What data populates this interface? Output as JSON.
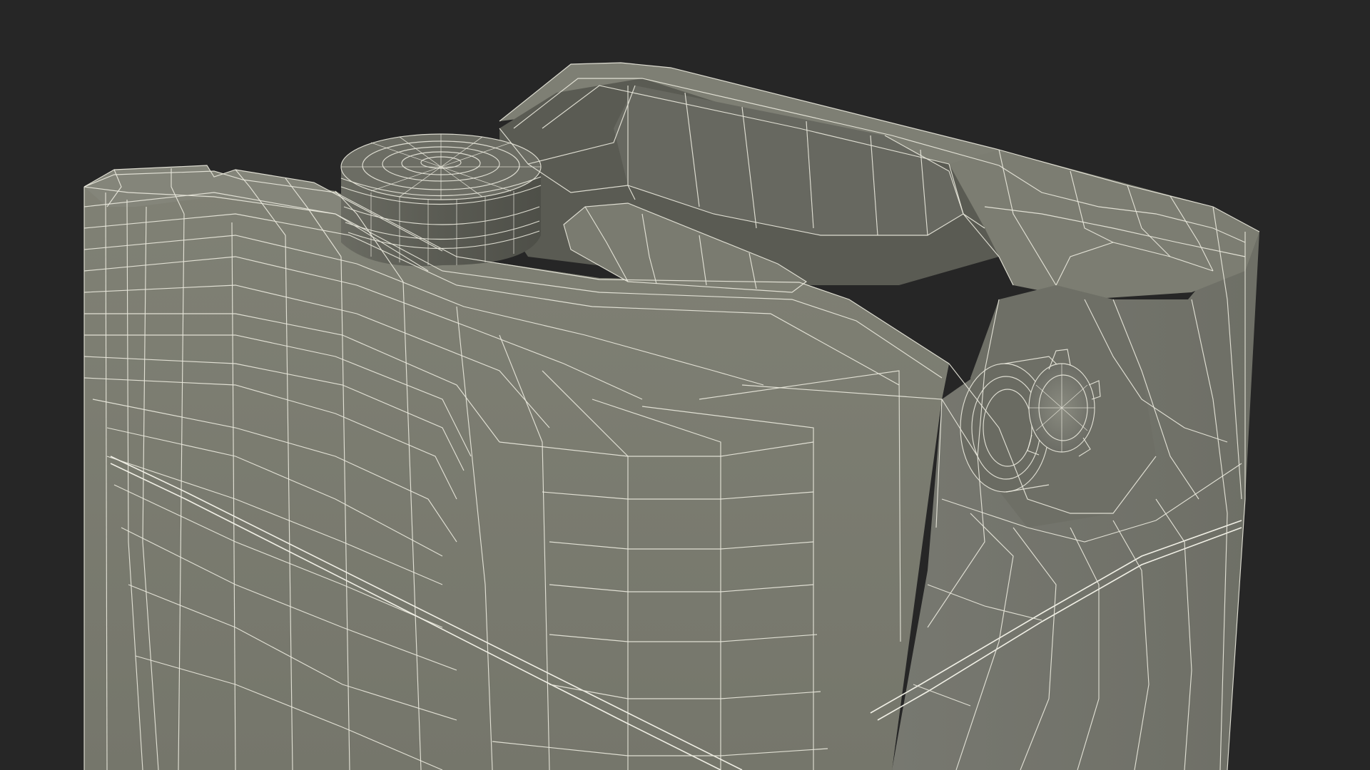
{
  "scene": {
    "subject": "jerry-can-wireframe",
    "render_mode": "wireframe-on-shaded",
    "colors": {
      "background": "#262626",
      "surface_front": "#7b7c70",
      "surface_side": "#747569",
      "surface_top": "#84857a",
      "surface_shadow": "#5c5d54",
      "surface_dark": "#4a4b44",
      "wire": "#e9e8dc"
    },
    "icons": {
      "top_cap": "screw-cap-icon",
      "side_cap": "vent-cap-icon"
    }
  }
}
